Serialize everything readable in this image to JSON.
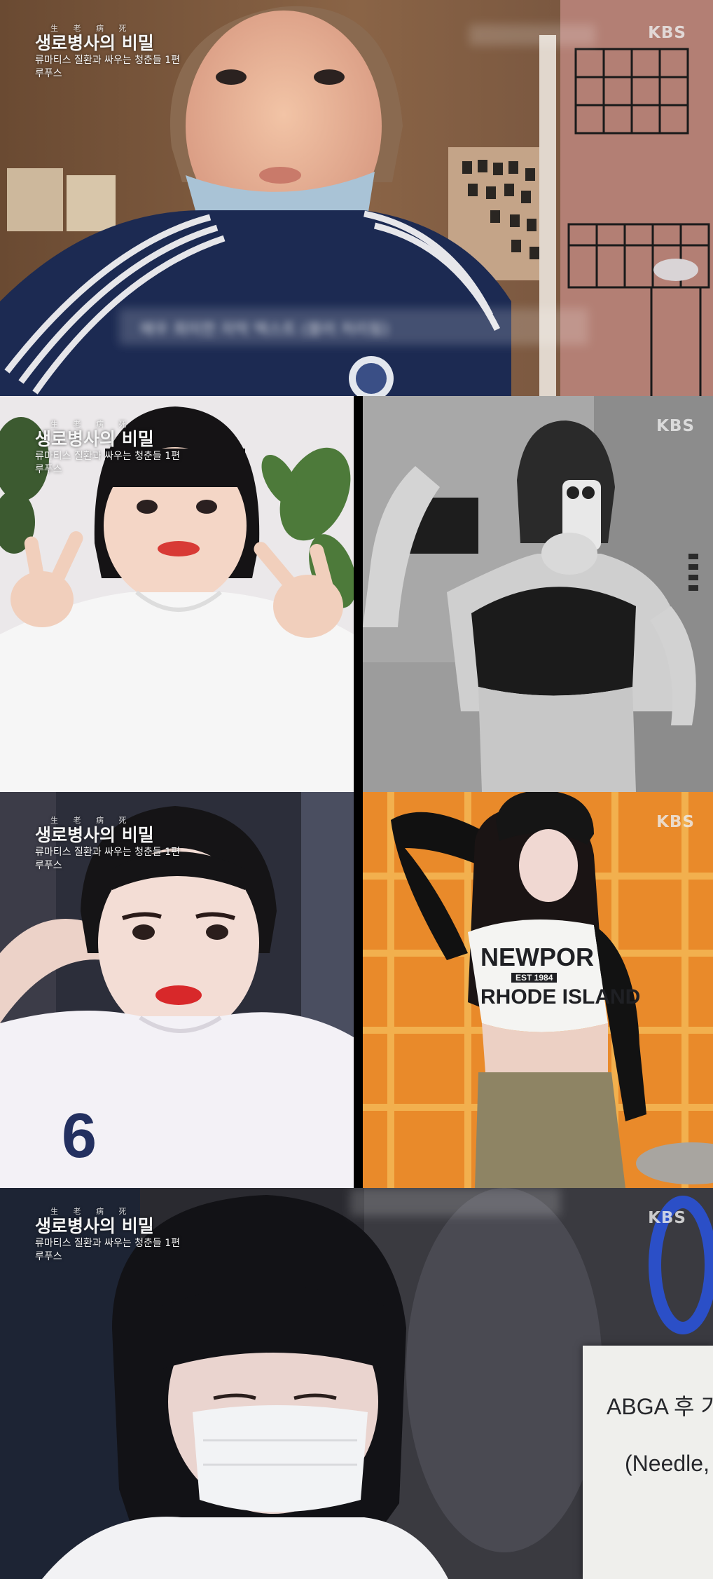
{
  "broadcaster": "KBS",
  "program": {
    "small_top": "生 老 病 死",
    "title": "생로병사의 비밀",
    "subtitle": "류마티스 질환과 싸우는 청춘들 1편",
    "name": "루푸스"
  },
  "blurred_caption": "매우 희미한 자막 텍스트 (블러 처리됨)",
  "shirt_print": {
    "line1": "NEWPOR",
    "line2": "EST 1984",
    "line3": "RHODE ISLAND"
  },
  "shirt_number": "6",
  "sign": {
    "line1": "ABGA 후 기",
    "line2": "(Needle,"
  }
}
